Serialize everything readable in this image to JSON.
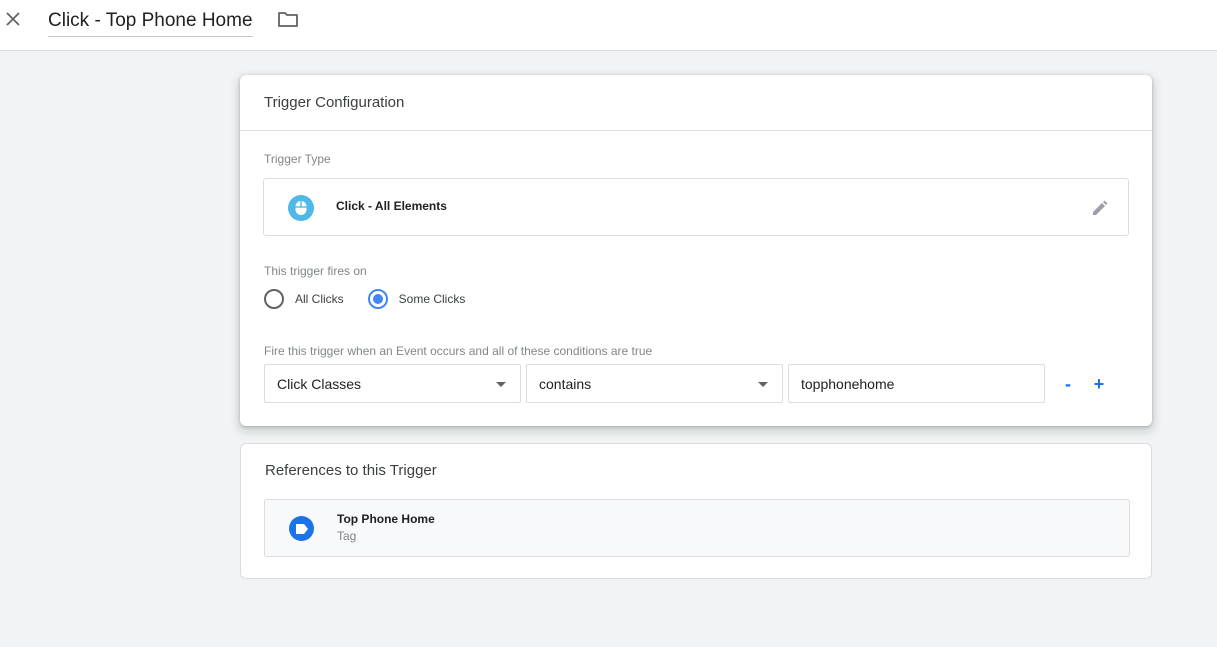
{
  "header": {
    "title": "Click - Top Phone Home",
    "close_icon": "close-icon",
    "folder_icon": "folder-icon"
  },
  "config": {
    "title": "Trigger Configuration",
    "trigger_type_label": "Trigger Type",
    "trigger_type": {
      "name": "Click - All Elements",
      "icon": "mouse-icon",
      "icon_color": "#4fb8e8"
    },
    "fires_on_label": "This trigger fires on",
    "fires_on_options": [
      {
        "label": "All Clicks",
        "selected": false
      },
      {
        "label": "Some Clicks",
        "selected": true
      }
    ],
    "condition_label": "Fire this trigger when an Event occurs and all of these conditions are true",
    "condition": {
      "variable": "Click Classes",
      "operator": "contains",
      "value": "topphonehome",
      "remove_label": "-",
      "add_label": "+"
    }
  },
  "references": {
    "title": "References to this Trigger",
    "items": [
      {
        "name": "Top Phone Home",
        "type": "Tag",
        "icon": "tag-icon",
        "icon_color": "#1a73e8"
      }
    ]
  },
  "colors": {
    "accent": "#1a73e8",
    "radio_selected": "#4285f4",
    "background": "#f1f3f4"
  }
}
